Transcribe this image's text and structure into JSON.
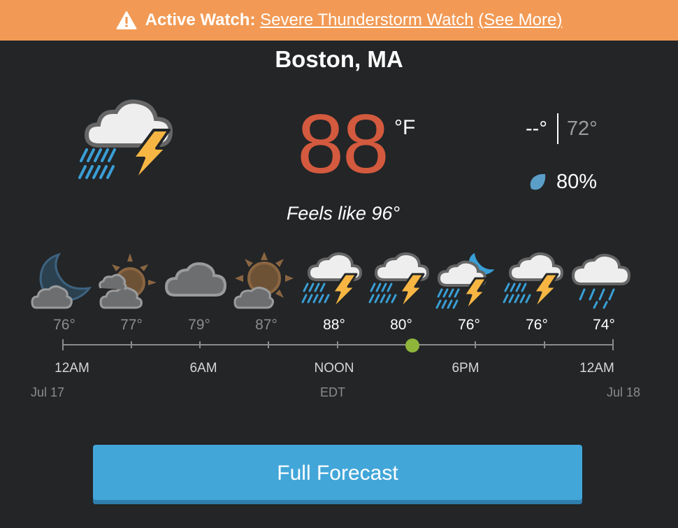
{
  "alert": {
    "label": "Active Watch:",
    "title": "Severe Thunderstorm Watch",
    "more_open": "(",
    "more_text": "See More",
    "more_close": ")",
    "icon": "warning-icon"
  },
  "location": "Boston, MA",
  "current": {
    "temp": "88",
    "unit": "°F",
    "feels_like": "Feels like 96°",
    "high": "--°",
    "low": "72°",
    "precip": "80%",
    "condition_icon": "thunderstorm-rain-icon"
  },
  "hourly": [
    {
      "temp": "76°",
      "icon": "night-cloudy-icon",
      "state": "past"
    },
    {
      "temp": "77°",
      "icon": "sun-cloudy-icon",
      "state": "past"
    },
    {
      "temp": "79°",
      "icon": "cloudy-icon",
      "state": "past"
    },
    {
      "temp": "87°",
      "icon": "partly-sunny-icon",
      "state": "past"
    },
    {
      "temp": "88°",
      "icon": "thunderstorm-icon",
      "state": "future"
    },
    {
      "temp": "80°",
      "icon": "thunderstorm-icon",
      "state": "future"
    },
    {
      "temp": "76°",
      "icon": "night-thunderstorm-icon",
      "state": "future"
    },
    {
      "temp": "76°",
      "icon": "thunderstorm-icon",
      "state": "future"
    },
    {
      "temp": "74°",
      "icon": "rain-icon",
      "state": "future"
    }
  ],
  "timeline": {
    "labels": [
      "12AM",
      "6AM",
      "NOON",
      "6PM",
      "12AM"
    ],
    "start_date": "Jul 17",
    "timezone": "EDT",
    "end_date": "Jul 18"
  },
  "button_label": "Full Forecast",
  "colors": {
    "background": "#232527",
    "banner": "#f29a55",
    "temperature": "#d35a3e",
    "button": "#42a6d8",
    "now_indicator": "#8fb53b",
    "lightning": "#f7b643",
    "rain": "#3a9fd6"
  }
}
